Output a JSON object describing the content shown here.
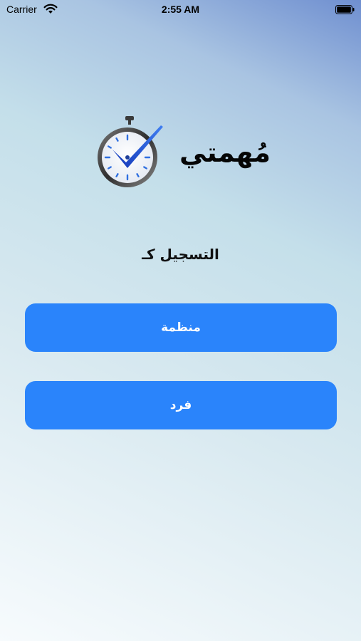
{
  "status_bar": {
    "carrier": "Carrier",
    "time": "2:55 AM"
  },
  "app": {
    "name": "مُهمتي",
    "logo_icon": "stopwatch-check-icon",
    "accent_color": "#2a84fb"
  },
  "register": {
    "heading": "التسجيل كـ",
    "organization_label": "منظمة",
    "individual_label": "فرد"
  }
}
